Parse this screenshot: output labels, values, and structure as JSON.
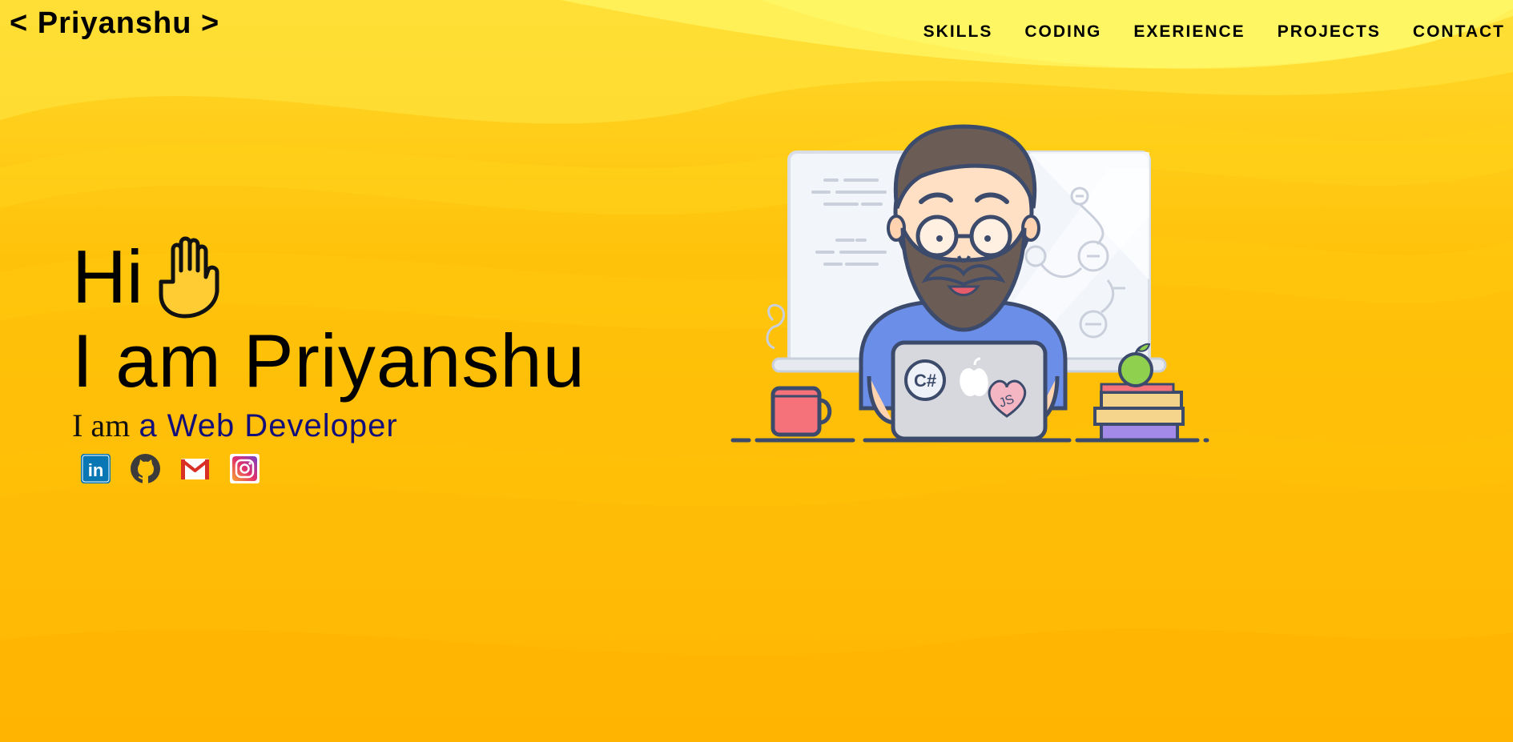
{
  "header": {
    "logo": "< Priyanshu >",
    "nav": [
      "SKILLS",
      "CODING",
      "EXERIENCE",
      "PROJECTS",
      "CONTACT"
    ]
  },
  "hero": {
    "greeting": "Hi",
    "name_line": "I am Priyanshu",
    "role_prefix": "I am",
    "role": "a Web Developer"
  },
  "socials": [
    {
      "name": "linkedin-icon",
      "label": "in"
    },
    {
      "name": "github-icon"
    },
    {
      "name": "gmail-icon"
    },
    {
      "name": "instagram-icon"
    }
  ],
  "illustration": {
    "laptop_sticker_1": "C#",
    "laptop_sticker_2": "JS"
  },
  "colors": {
    "background_top": "#ffd92b",
    "background_bottom": "#ffb703",
    "role_text": "#120e7a",
    "text": "#000000"
  }
}
